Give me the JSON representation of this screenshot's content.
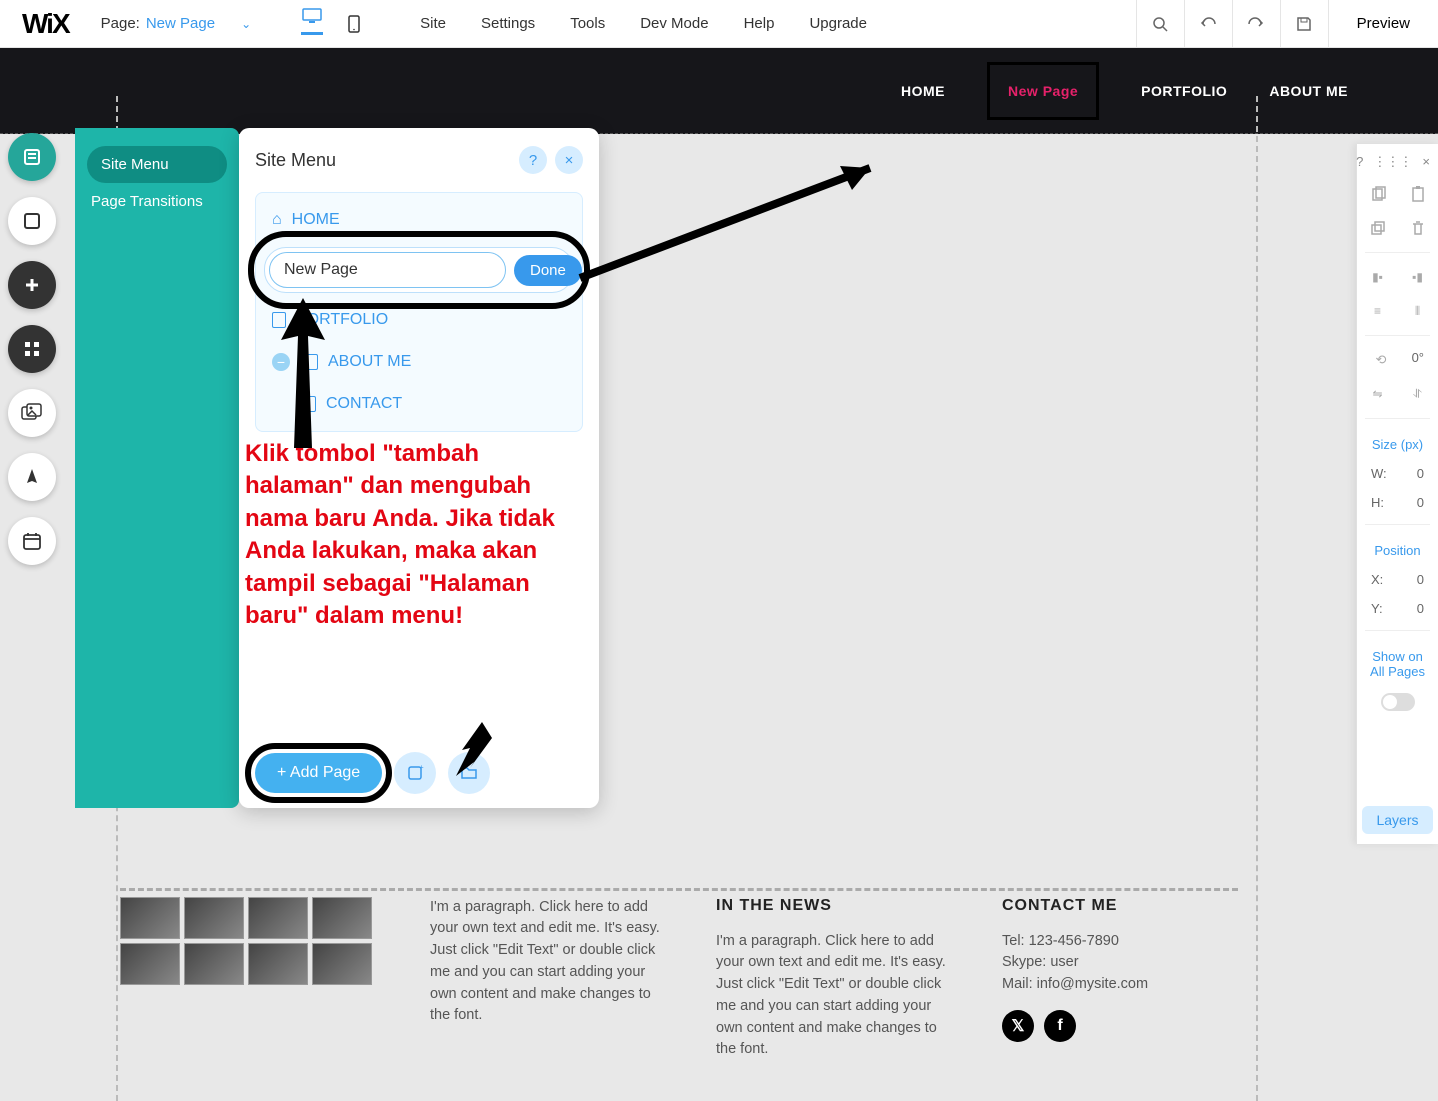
{
  "topbar": {
    "logo": "WiX",
    "page_label": "Page:",
    "page_name": "New Page",
    "menu": [
      "Site",
      "Settings",
      "Tools",
      "Dev Mode",
      "Help",
      "Upgrade"
    ],
    "preview": "Preview"
  },
  "site_nav": {
    "items": [
      "HOME",
      "New Page",
      "PORTFOLIO",
      "ABOUT ME"
    ],
    "active_index": 1
  },
  "side_panel": {
    "tabs": [
      "Site Menu",
      "Page Transitions"
    ],
    "active_index": 0
  },
  "menu_panel": {
    "title": "Site Menu",
    "items": {
      "home": "HOME",
      "new_page_value": "New Page",
      "done": "Done",
      "portfolio": "PORTFOLIO",
      "about": "ABOUT ME",
      "contact": "CONTACT"
    },
    "add_page": "+ Add Page"
  },
  "annotation": "Klik tombol \"tambah halaman\" dan mengubah nama baru Anda. Jika tidak Anda lakukan, maka akan tampil sebagai \"Halaman baru\" dalam menu!",
  "footer": {
    "news_title": "IN THE NEWS",
    "contact_title": "CONTACT ME",
    "paragraph": "I'm a paragraph. Click here to add your own text and edit me. It's easy. Just click \"Edit Text\" or double click me and you can start adding your own content and make changes to the font.",
    "contact_lines": [
      "Tel: 123-456-7890",
      "Skype: user",
      "Mail: info@mysite.com"
    ]
  },
  "right_panel": {
    "rotation": "0°",
    "size_title": "Size (px)",
    "w_label": "W:",
    "w_value": "0",
    "h_label": "H:",
    "h_value": "0",
    "pos_title": "Position",
    "x_label": "X:",
    "x_value": "0",
    "y_label": "Y:",
    "y_value": "0",
    "show_all": "Show on All Pages",
    "layers": "Layers",
    "help": "?",
    "close": "×"
  }
}
